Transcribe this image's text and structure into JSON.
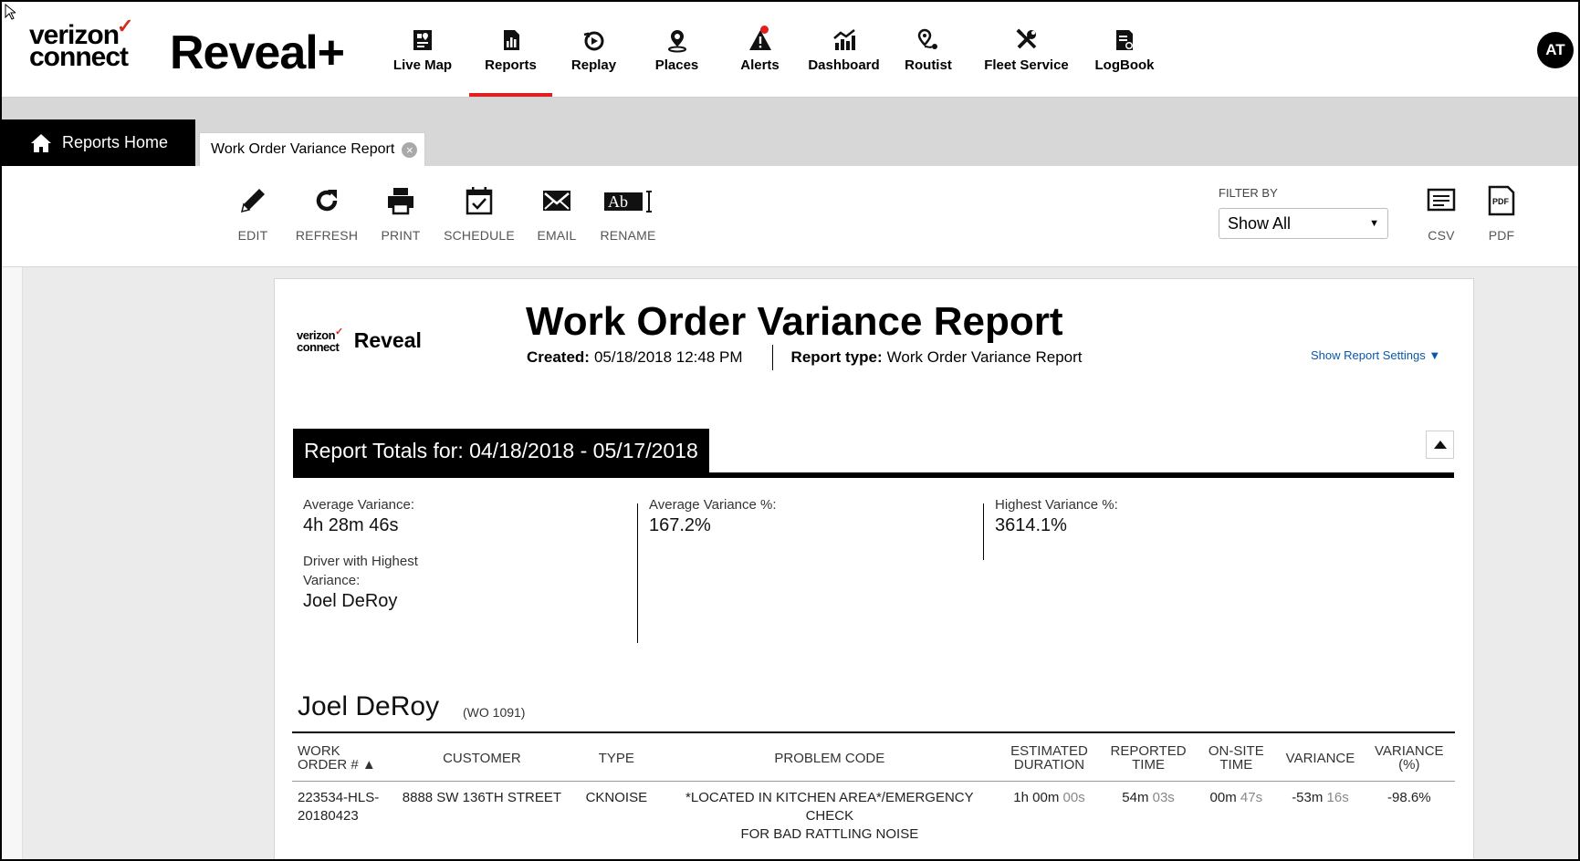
{
  "app": {
    "logo_line1": "verizon",
    "logo_check": "✓",
    "logo_line2": "connect",
    "product": "Reveal+",
    "user_initials": "AT"
  },
  "nav": [
    {
      "label": "Live Map",
      "icon": "map-icon"
    },
    {
      "label": "Reports",
      "icon": "report-icon",
      "active": true
    },
    {
      "label": "Replay",
      "icon": "replay-icon"
    },
    {
      "label": "Places",
      "icon": "place-pin-icon"
    },
    {
      "label": "Alerts",
      "icon": "alert-icon",
      "badge": true
    },
    {
      "label": "Dashboard",
      "icon": "dashboard-icon"
    },
    {
      "label": "Routist",
      "icon": "routist-icon"
    },
    {
      "label": "Fleet Service",
      "icon": "wrench-icon"
    },
    {
      "label": "LogBook",
      "icon": "logbook-icon"
    }
  ],
  "tabs": {
    "home": "Reports Home",
    "current": "Work Order Variance Report"
  },
  "toolbar": {
    "edit": "EDIT",
    "refresh": "REFRESH",
    "print": "PRINT",
    "schedule": "SCHEDULE",
    "email": "EMAIL",
    "rename": "RENAME",
    "rename_glyph": "Ab",
    "filter_label": "FILTER BY",
    "filter_value": "Show All",
    "csv": "CSV",
    "pdf": "PDF",
    "pdf_glyph": "PDF"
  },
  "report": {
    "logo_line1": "verizon",
    "logo_line2": "connect",
    "logo_product": "Reveal",
    "title": "Work Order Variance Report",
    "created_label": "Created:",
    "created_value": "05/18/2018 12:48 PM",
    "type_label": "Report type:",
    "type_value": "Work Order Variance Report",
    "settings_link": "Show Report Settings ▼",
    "totals_title": "Report Totals for: 04/18/2018 - 05/17/2018",
    "stats": {
      "avg_variance_label": "Average Variance:",
      "avg_variance_value": "4h 28m 46s",
      "driver_highest_label_1": "Driver with Highest",
      "driver_highest_label_2": "Variance:",
      "driver_highest_value": "Joel DeRoy",
      "avg_variance_pct_label": "Average Variance %:",
      "avg_variance_pct_value": "167.2%",
      "highest_variance_pct_label": "Highest Variance %:",
      "highest_variance_pct_value": "3614.1%"
    },
    "driver": {
      "name": "Joel DeRoy",
      "wo": "(WO 1091)"
    },
    "table": {
      "headers": {
        "work_order_1": "WORK",
        "work_order_2": "ORDER # ▲",
        "customer": "CUSTOMER",
        "type": "TYPE",
        "problem_code": "PROBLEM CODE",
        "estimated_1": "ESTIMATED",
        "estimated_2": "DURATION",
        "reported_1": "REPORTED",
        "reported_2": "TIME",
        "onsite_1": "ON-SITE",
        "onsite_2": "TIME",
        "variance": "VARIANCE",
        "variance_pct_1": "VARIANCE",
        "variance_pct_2": "(%)"
      },
      "rows": [
        {
          "work_order_1": "223534-HLS-",
          "work_order_2": "20180423",
          "customer": "8888 SW 136TH STREET",
          "type": "CKNOISE",
          "problem_code_1": "*LOCATED IN KITCHEN AREA*/EMERGENCY CHECK",
          "problem_code_2": "FOR BAD RATTLING NOISE",
          "est_main": "1h 00m",
          "est_sub": "00s",
          "rep_main": "54m",
          "rep_sub": "03s",
          "onsite_main": "00m",
          "onsite_sub": "47s",
          "var_main": "-53m",
          "var_sub": "16s",
          "var_pct": "-98.6%"
        }
      ]
    }
  },
  "colors": {
    "accent_red": "#e02020",
    "link_blue": "#0a58a8",
    "tabstrip_gray": "#d7d7d7",
    "content_gray": "#ebebeb"
  }
}
